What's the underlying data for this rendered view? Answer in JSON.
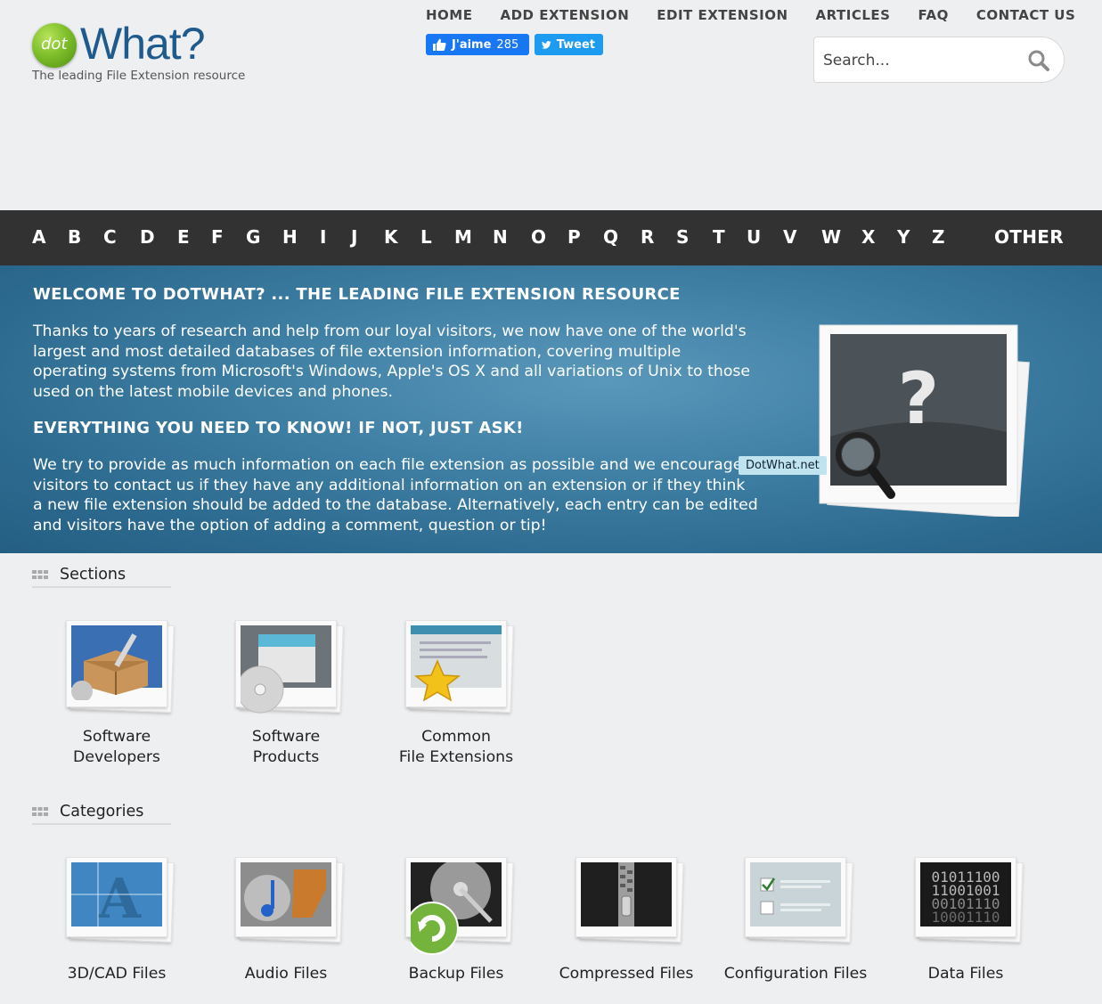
{
  "logo": {
    "dot": "dot",
    "word": "What?",
    "tagline": "The leading File Extension resource"
  },
  "nav": [
    {
      "label": "HOME"
    },
    {
      "label": "ADD EXTENSION"
    },
    {
      "label": "EDIT EXTENSION"
    },
    {
      "label": "ARTICLES"
    },
    {
      "label": "FAQ"
    },
    {
      "label": "CONTACT US"
    }
  ],
  "social": {
    "like_label": "J'aime",
    "like_count": "285",
    "tweet_label": "Tweet"
  },
  "search": {
    "placeholder": "Search..."
  },
  "alphabet": [
    "A",
    "B",
    "C",
    "D",
    "E",
    "F",
    "G",
    "H",
    "I",
    "J",
    "K",
    "L",
    "M",
    "N",
    "O",
    "P",
    "Q",
    "R",
    "S",
    "T",
    "U",
    "V",
    "W",
    "X",
    "Y",
    "Z"
  ],
  "alphabet_other": "OTHER",
  "banner": {
    "heading1": "WELCOME TO DOTWHAT? ... THE LEADING FILE EXTENSION RESOURCE",
    "para1": "Thanks to years of research and help from our loyal visitors, we now have one of the world's largest and most detailed databases of file extension information, covering multiple operating systems from Microsoft's Windows, Apple's OS X and all variations of Unix to those used on the latest mobile devices and phones.",
    "heading2": "EVERYTHING YOU NEED TO KNOW! IF NOT, JUST ASK!",
    "para2": "We try to provide as much information on each file extension as possible and we encourage visitors to contact us if they have any additional information on an extension or if they think a new file extension should be added to the database. Alternatively, each entry can be edited and visitors have the option of adding a comment, question or tip!",
    "tooltip": "DotWhat.net"
  },
  "sections": {
    "title": "Sections",
    "items": [
      {
        "line1": "Software",
        "line2": "Developers",
        "icon": "software-developers-icon"
      },
      {
        "line1": "Software",
        "line2": "Products",
        "icon": "software-products-icon"
      },
      {
        "line1": "Common",
        "line2": "File Extensions",
        "icon": "common-extensions-icon"
      }
    ]
  },
  "categories": {
    "title": "Categories",
    "items": [
      {
        "label": "3D/CAD Files",
        "icon": "cad-icon"
      },
      {
        "label": "Audio Files",
        "icon": "audio-icon"
      },
      {
        "label": "Backup Files",
        "icon": "backup-icon"
      },
      {
        "label": "Compressed Files",
        "icon": "compressed-icon"
      },
      {
        "label": "Configuration Files",
        "icon": "configuration-icon"
      },
      {
        "label": "Data Files",
        "icon": "data-icon",
        "binary": [
          "01011100",
          "11001001",
          "00101110",
          "10001110"
        ]
      }
    ]
  },
  "colors": {
    "alphabar": "#323232",
    "banner": "#3f7fa4",
    "background": "#eeeff1",
    "brand_green": "#7fbf2a",
    "brand_blue": "#1f5a8c"
  }
}
